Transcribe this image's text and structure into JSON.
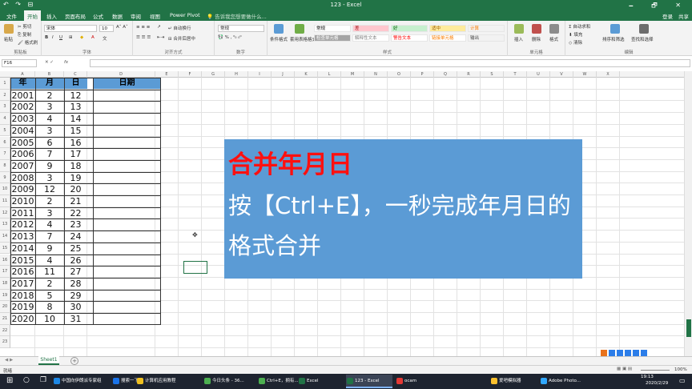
{
  "title_bar": {
    "title": "123 - Excel",
    "quick_access": "↶ ↷ ⊟",
    "window_controls": "🗕 🗗 ✕"
  },
  "ribbon_tabs": [
    "文件",
    "开始",
    "插入",
    "页面布局",
    "公式",
    "数据",
    "审阅",
    "视图",
    "Power Pivot"
  ],
  "active_tab": "开始",
  "tell_me": "告诉我您想要做什么...",
  "user": "登录",
  "share": "共享",
  "ribbon": {
    "clipboard": {
      "paste": "粘贴",
      "cut": "剪切",
      "copy": "复制",
      "format_painter": "格式刷",
      "label": "剪贴板"
    },
    "font": {
      "name": "宋体",
      "size": "10",
      "label": "字体"
    },
    "alignment": {
      "wrap": "自动换行",
      "merge": "合并后居中",
      "label": "对齐方式"
    },
    "number": {
      "format": "常规",
      "label": "数字"
    },
    "styles": {
      "conditional": "条件格式",
      "table": "套用表格格式",
      "cells_styles": [
        {
          "name": "常规",
          "bg": "#ffffff",
          "fg": "#000000"
        },
        {
          "name": "差",
          "bg": "#ffc7ce",
          "fg": "#9c0006"
        },
        {
          "name": "好",
          "bg": "#c6efce",
          "fg": "#006100"
        },
        {
          "name": "适中",
          "bg": "#ffeb9c",
          "fg": "#9c5700"
        },
        {
          "name": "计算",
          "bg": "#f2f2f2",
          "fg": "#fa7d00"
        },
        {
          "name": "检查单元格",
          "bg": "#a5a5a5",
          "fg": "#ffffff"
        },
        {
          "name": "解释性文本",
          "bg": "#ffffff",
          "fg": "#7f7f7f"
        },
        {
          "name": "警告文本",
          "bg": "#ffffff",
          "fg": "#ff0000"
        },
        {
          "name": "链接单元格",
          "bg": "#ffffff",
          "fg": "#fa7d00"
        },
        {
          "name": "输出",
          "bg": "#f2f2f2",
          "fg": "#3f3f3f"
        }
      ],
      "label": "样式"
    },
    "cells": {
      "insert": "插入",
      "delete": "删除",
      "format": "格式",
      "label": "单元格"
    },
    "editing": {
      "autosum": "自动求和",
      "fill": "填充",
      "clear": "清除",
      "sort": "排序和筛选",
      "find": "查找和选择",
      "label": "编辑"
    }
  },
  "formula_bar": {
    "name_box": "F16",
    "fx": "fx",
    "value": ""
  },
  "columns": [
    "A",
    "B",
    "C",
    "D",
    "E",
    "F",
    "G",
    "H",
    "I",
    "J",
    "K",
    "L",
    "M",
    "N",
    "O",
    "P",
    "Q",
    "R",
    "S",
    "T",
    "U",
    "V",
    "W",
    "X"
  ],
  "rows": [
    "1",
    "2",
    "3",
    "4",
    "5",
    "6",
    "7",
    "8",
    "9",
    "10",
    "11",
    "12",
    "13",
    "14",
    "15",
    "16",
    "17",
    "18",
    "19",
    "20",
    "21",
    "22",
    "23"
  ],
  "table": {
    "headers": [
      "年",
      "月",
      "日",
      "日期"
    ],
    "data": [
      [
        "2001",
        "2",
        "12"
      ],
      [
        "2002",
        "3",
        "13"
      ],
      [
        "2003",
        "4",
        "14"
      ],
      [
        "2004",
        "3",
        "15"
      ],
      [
        "2005",
        "6",
        "16"
      ],
      [
        "2006",
        "7",
        "17"
      ],
      [
        "2007",
        "9",
        "18"
      ],
      [
        "2008",
        "3",
        "19"
      ],
      [
        "2009",
        "12",
        "20"
      ],
      [
        "2010",
        "2",
        "21"
      ],
      [
        "2011",
        "3",
        "22"
      ],
      [
        "2012",
        "4",
        "23"
      ],
      [
        "2013",
        "7",
        "24"
      ],
      [
        "2014",
        "9",
        "25"
      ],
      [
        "2015",
        "4",
        "26"
      ],
      [
        "2016",
        "11",
        "27"
      ],
      [
        "2017",
        "2",
        "28"
      ],
      [
        "2018",
        "5",
        "29"
      ],
      [
        "2019",
        "8",
        "30"
      ],
      [
        "2020",
        "10",
        "31"
      ]
    ]
  },
  "overlay": {
    "title": "合并年月日",
    "body": "按【Ctrl+E】，一秒完成年月日的格式合并"
  },
  "sheet_tab": "Sheet1",
  "add_sheet": "+",
  "status": {
    "ready": "就绪",
    "zoom": "100%"
  },
  "taskbar": {
    "items": [
      {
        "label": "中国向伊朗派专家组",
        "color": "#1e88e5"
      },
      {
        "label": "搜索一下",
        "color": "#1a73e8"
      },
      {
        "label": "计算机应用教程",
        "color": "#f0c020"
      },
      {
        "label": "今日头条 - 36...",
        "color": "#4caf50"
      },
      {
        "label": "Ctrl+E，拥有...",
        "color": "#4caf50"
      },
      {
        "label": "Excel",
        "color": "#217346"
      },
      {
        "label": "123 - Excel",
        "color": "#217346"
      },
      {
        "label": "ocam",
        "color": "#e53935"
      },
      {
        "label": "爱吧模拟器",
        "color": "#fbc02d"
      },
      {
        "label": "Adobe Photo...",
        "color": "#31a8ff"
      }
    ],
    "time": "19:13",
    "date": "2020/2/29"
  }
}
